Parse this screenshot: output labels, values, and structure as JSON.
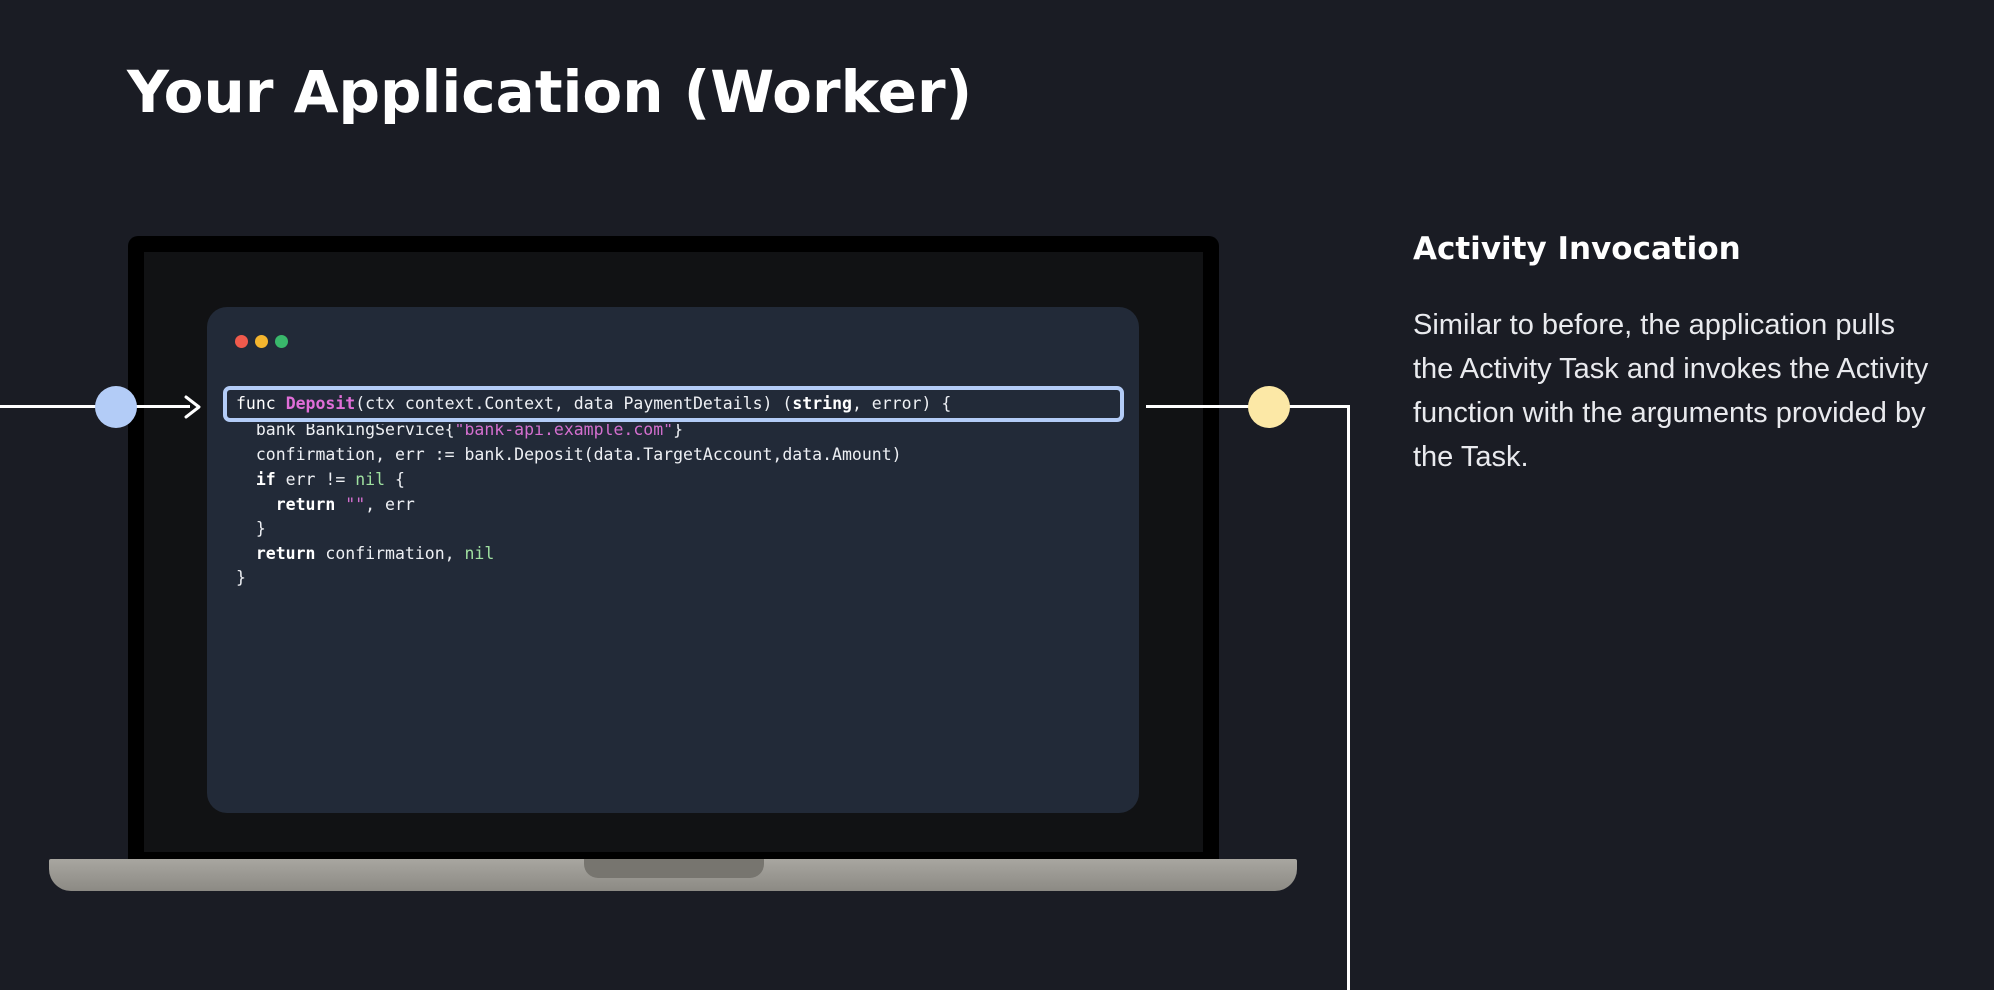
{
  "page": {
    "title": "Your Application (Worker)"
  },
  "panel": {
    "heading": "Activity Invocation",
    "body": "Similar to before, the application pulls the Activity Task and invokes the Activity function with the arguments provided by the Task."
  },
  "code": {
    "line1": {
      "kw": "func",
      "sp1": " ",
      "fn_name": "Deposit",
      "params": "(ctx context.Context, data PaymentDetails) (",
      "ret_type": "string",
      "tail": ", error) {"
    },
    "line2": {
      "text": "  bank BankingService{",
      "str": "\"bank-api.example.com\"",
      "tail": "}"
    },
    "line3": {
      "text": "  confirmation, err := bank.Deposit(data.TargetAccount,data.Amount)"
    },
    "line4": {
      "indent": "  ",
      "kw": "if",
      "mid": " err != ",
      "nil": "nil",
      "tail": " {"
    },
    "line5": {
      "indent": "    ",
      "kw": "return",
      "sp": " ",
      "str": "\"\"",
      "tail": ", err"
    },
    "line6": {
      "text": "  }"
    },
    "line7": {
      "indent": "  ",
      "kw": "return",
      "mid": " confirmation, ",
      "nil": "nil"
    },
    "line8": {
      "text": "}"
    }
  },
  "colors": {
    "background": "#1a1c24",
    "editor": "#222a38",
    "function_name": "#e06ed8",
    "string": "#d46fcf",
    "nil": "#9fe0a0",
    "highlight_border": "#b3ccf7",
    "node_in": "#b3ccf7",
    "node_out": "#fce8a6",
    "dot_red": "#f05a4c",
    "dot_yellow": "#f5b52e",
    "dot_green": "#39b86b"
  },
  "icons": {
    "window_controls": [
      "close-dot",
      "minimize-dot",
      "maximize-dot"
    ],
    "arrow": "arrow-right-icon",
    "node_in": "input-node-icon",
    "node_out": "output-node-icon"
  }
}
